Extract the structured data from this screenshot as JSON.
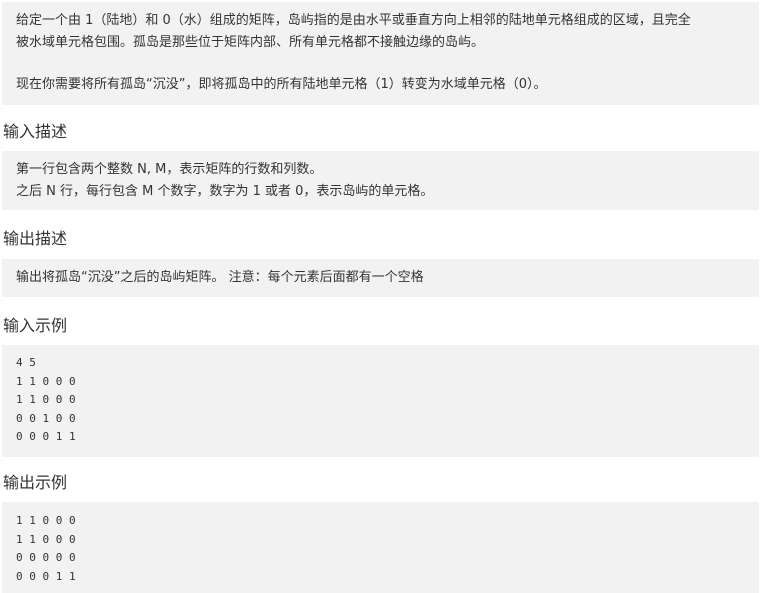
{
  "problem": {
    "description_line1": "给定一个由 1（陆地）和 0（水）组成的矩阵，岛屿指的是由水平或垂直方向上相邻的陆地单元格组成的区域，且完全",
    "description_line2": "被水域单元格包围。孤岛是那些位于矩阵内部、所有单元格都不接触边缘的岛屿。",
    "description_line3": "现在你需要将所有孤岛“沉没”，即将孤岛中的所有陆地单元格（1）转变为水域单元格（0）。"
  },
  "input_section": {
    "heading": "输入描述",
    "line1": "第一行包含两个整数 N, M，表示矩阵的行数和列数。",
    "line2": "之后 N 行，每行包含 M 个数字，数字为 1 或者 0，表示岛屿的单元格。"
  },
  "output_section": {
    "heading": "输出描述",
    "line1": "输出将孤岛“沉没”之后的岛屿矩阵。 注意：每个元素后面都有一个空格"
  },
  "input_example": {
    "heading": "输入示例",
    "lines": [
      "4 5",
      "1 1 0 0 0",
      "1 1 0 0 0",
      "0 0 1 0 0",
      "0 0 0 1 1"
    ]
  },
  "output_example": {
    "heading": "输出示例",
    "lines": [
      "1 1 0 0 0",
      "1 1 0 0 0",
      "0 0 0 0 0",
      "0 0 0 1 1"
    ]
  }
}
